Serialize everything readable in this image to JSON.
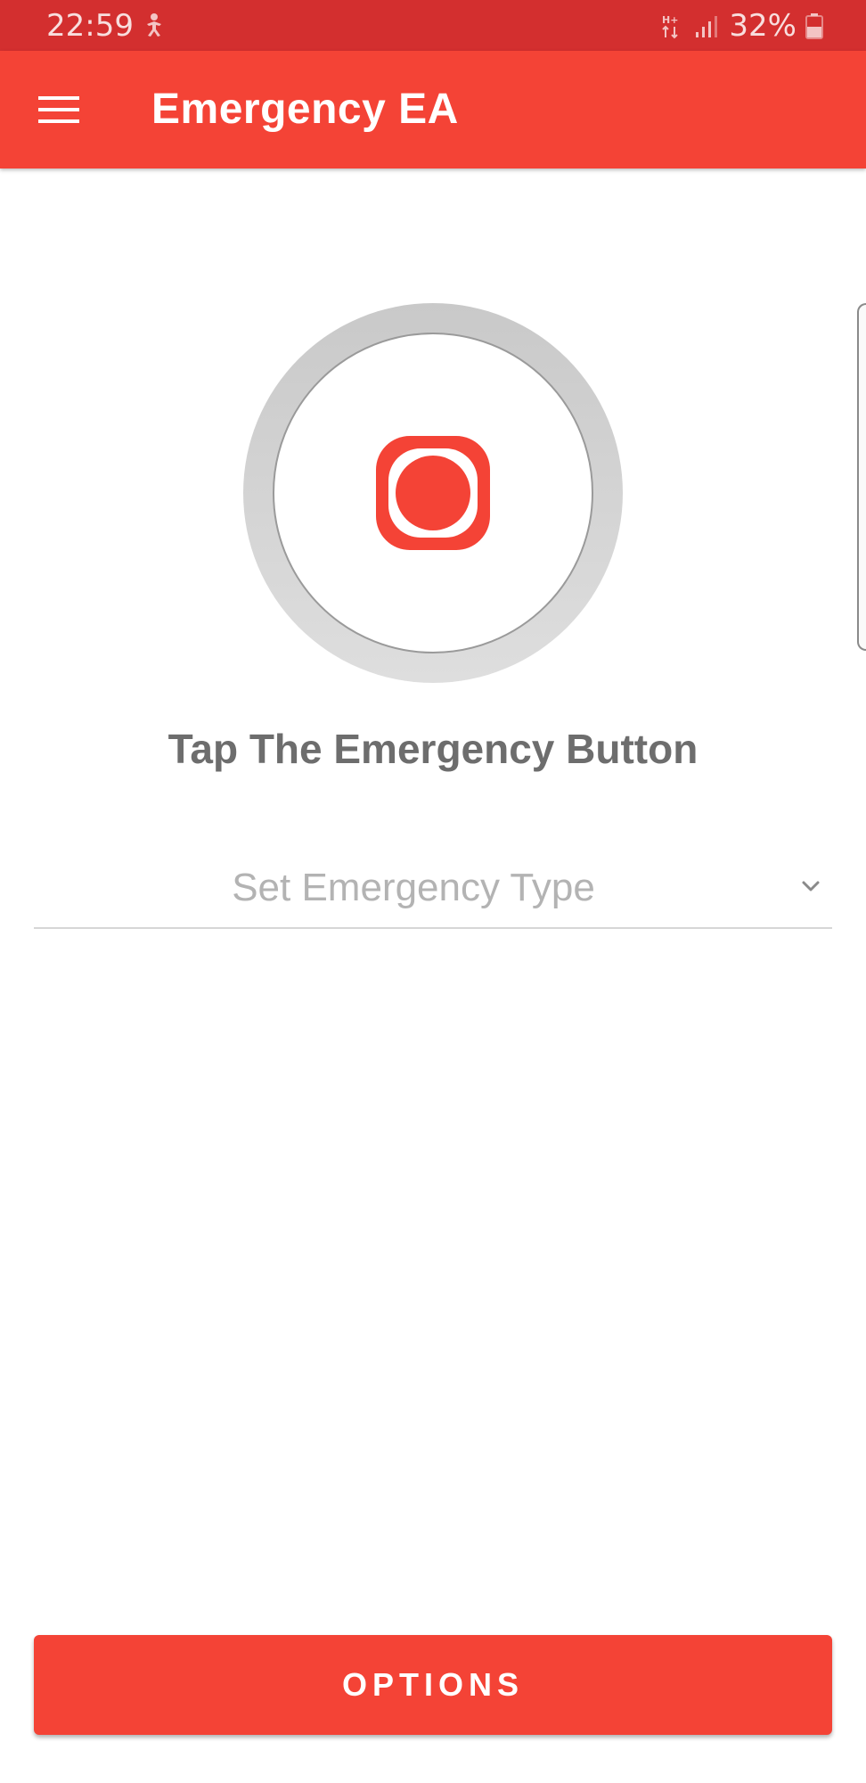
{
  "status_bar": {
    "time": "22:59",
    "notification_icon": "accessibility-icon",
    "network_icon": "data-transfer-icon",
    "signal_icon": "signal-bars-icon",
    "battery_percent": "32%",
    "battery_icon": "battery-low-icon"
  },
  "app_bar": {
    "menu_icon": "hamburger-menu-icon",
    "title": "Emergency EA"
  },
  "emergency": {
    "button_icon": "record-icon",
    "heading": "Tap The Emergency Button"
  },
  "emergency_type": {
    "placeholder": "Set Emergency Type",
    "chevron_icon": "chevron-down-icon"
  },
  "options_button": {
    "label": "OPTIONS"
  },
  "colors": {
    "status_bar": "#d32f2f",
    "app_bar": "#f44336",
    "accent": "#f44336",
    "heading_text": "#6d6d6d",
    "placeholder_text": "#b3b3b3"
  }
}
